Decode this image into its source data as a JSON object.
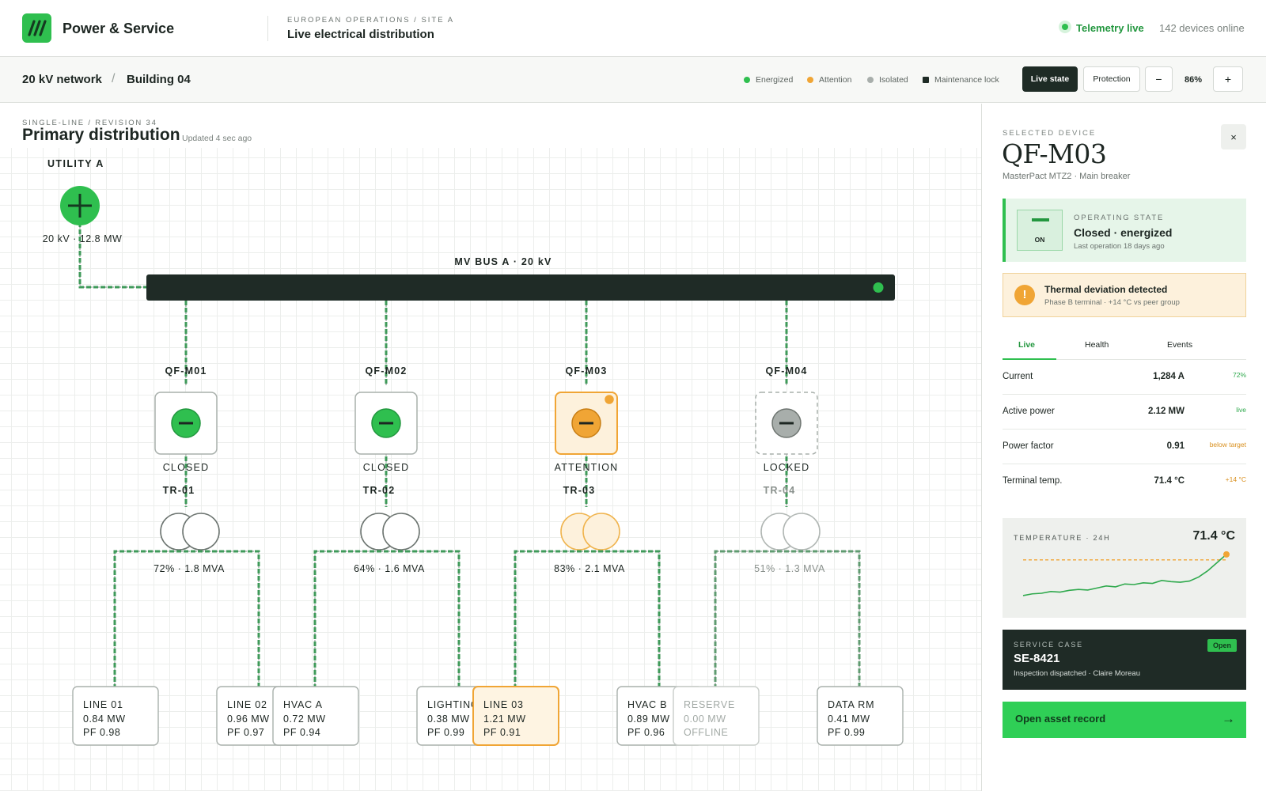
{
  "header": {
    "brand": "Power & Service",
    "site_kicker": "EUROPEAN OPERATIONS / SITE A",
    "site_title": "Live electrical distribution",
    "telemetry": "Telemetry live",
    "devices_online": "142 devices online"
  },
  "breadcrumb": {
    "network": "20 kV network",
    "separator": "/",
    "building": "Building 04"
  },
  "legend": [
    {
      "label": "Energized",
      "color": "#2fbf4f",
      "shape": "circle"
    },
    {
      "label": "Attention",
      "color": "#f0a535",
      "shape": "circle"
    },
    {
      "label": "Isolated",
      "color": "#a8aeab",
      "shape": "circle"
    },
    {
      "label": "Maintenance lock",
      "color": "#1e2b25",
      "shape": "square"
    }
  ],
  "toolbar": {
    "live_state": "Live state",
    "protection": "Protection",
    "zoom_out": "−",
    "zoom_in": "+",
    "zoom": "86%"
  },
  "canvas": {
    "kicker": "SINGLE-LINE / REVISION 34",
    "title": "Primary distribution",
    "updated": "Updated 4 sec ago",
    "source": {
      "name": "UTILITY A",
      "info": "20 kV · 12.8 MW"
    },
    "bus": {
      "name": "MV BUS A · 20 kV"
    },
    "feeders": [
      {
        "breaker": "QF-M01",
        "breaker_state": "CLOSED",
        "status": "energized",
        "transformer": "TR-01",
        "loading": "72% · 1.8 MVA",
        "loads": [
          {
            "name": "LINE 01",
            "power": "0.84 MW",
            "pf": "PF 0.98"
          },
          {
            "name": "LINE 02",
            "power": "0.96 MW",
            "pf": "PF 0.97"
          }
        ]
      },
      {
        "breaker": "QF-M02",
        "breaker_state": "CLOSED",
        "status": "energized",
        "transformer": "TR-02",
        "loading": "64% · 1.6 MVA",
        "loads": [
          {
            "name": "HVAC A",
            "power": "0.72 MW",
            "pf": "PF 0.94"
          },
          {
            "name": "LIGHTING",
            "power": "0.38 MW",
            "pf": "PF 0.99"
          }
        ]
      },
      {
        "breaker": "QF-M03",
        "breaker_state": "ATTENTION",
        "status": "attention",
        "transformer": "TR-03",
        "loading": "83% · 2.1 MVA",
        "loads": [
          {
            "name": "LINE 03",
            "power": "1.21 MW",
            "pf": "PF 0.91"
          },
          {
            "name": "HVAC B",
            "power": "0.89 MW",
            "pf": "PF 0.96"
          }
        ]
      },
      {
        "breaker": "QF-M04",
        "breaker_state": "LOCKED",
        "status": "locked",
        "transformer": "TR-04",
        "loading": "51% · 1.3 MVA",
        "loads": [
          {
            "name": "RESERVE",
            "power": "0.00 MW",
            "pf": "OFFLINE"
          },
          {
            "name": "DATA RM",
            "power": "0.41 MW",
            "pf": "PF 0.99"
          }
        ]
      }
    ]
  },
  "panel": {
    "kicker": "SELECTED DEVICE",
    "title": "QF-M03",
    "subtitle": "MasterPact MTZ2 · Main breaker",
    "close": "×",
    "state": {
      "kicker": "OPERATING STATE",
      "icon_label": "ON",
      "main": "Closed · energized",
      "sub": "Last operation 18 days ago"
    },
    "alert": {
      "icon": "!",
      "title": "Thermal deviation detected",
      "sub": "Phase B terminal · +14 °C vs peer group"
    },
    "tabs": [
      "Live",
      "Health",
      "Events"
    ],
    "metrics": [
      {
        "label": "Current",
        "value": "1,284 A",
        "note": "72%",
        "note_color": "#2fa94d"
      },
      {
        "label": "Active power",
        "value": "2.12 MW",
        "note": "live",
        "note_color": "#2fa94d"
      },
      {
        "label": "Power factor",
        "value": "0.91",
        "note": "below target",
        "note_color": "#d9901f"
      },
      {
        "label": "Terminal temp.",
        "value": "71.4 °C",
        "note": "+14 °C",
        "note_color": "#d9901f"
      }
    ],
    "trend": {
      "kicker": "TEMPERATURE · 24H",
      "value": "71.4 °C",
      "series": [
        57.2,
        57.8,
        58.0,
        58.6,
        58.4,
        59.0,
        59.3,
        59.1,
        59.8,
        60.5,
        60.2,
        61.2,
        61.0,
        61.6,
        61.4,
        62.4,
        62.0,
        61.8,
        62.2,
        63.6,
        65.8,
        68.6,
        71.4
      ],
      "threshold": 69.5
    },
    "service_case": {
      "kicker": "SERVICE CASE",
      "id": "SE-8421",
      "sub": "Inspection dispatched · Claire Moreau",
      "badge": "Open"
    },
    "asset_button": {
      "label": "Open asset record",
      "arrow": "→"
    }
  },
  "colors": {
    "energized": "#2fbf4f",
    "attention": "#f0a535",
    "isolated": "#a8aeab",
    "locked": "#1e2b25",
    "bus": "#1f2b26"
  }
}
